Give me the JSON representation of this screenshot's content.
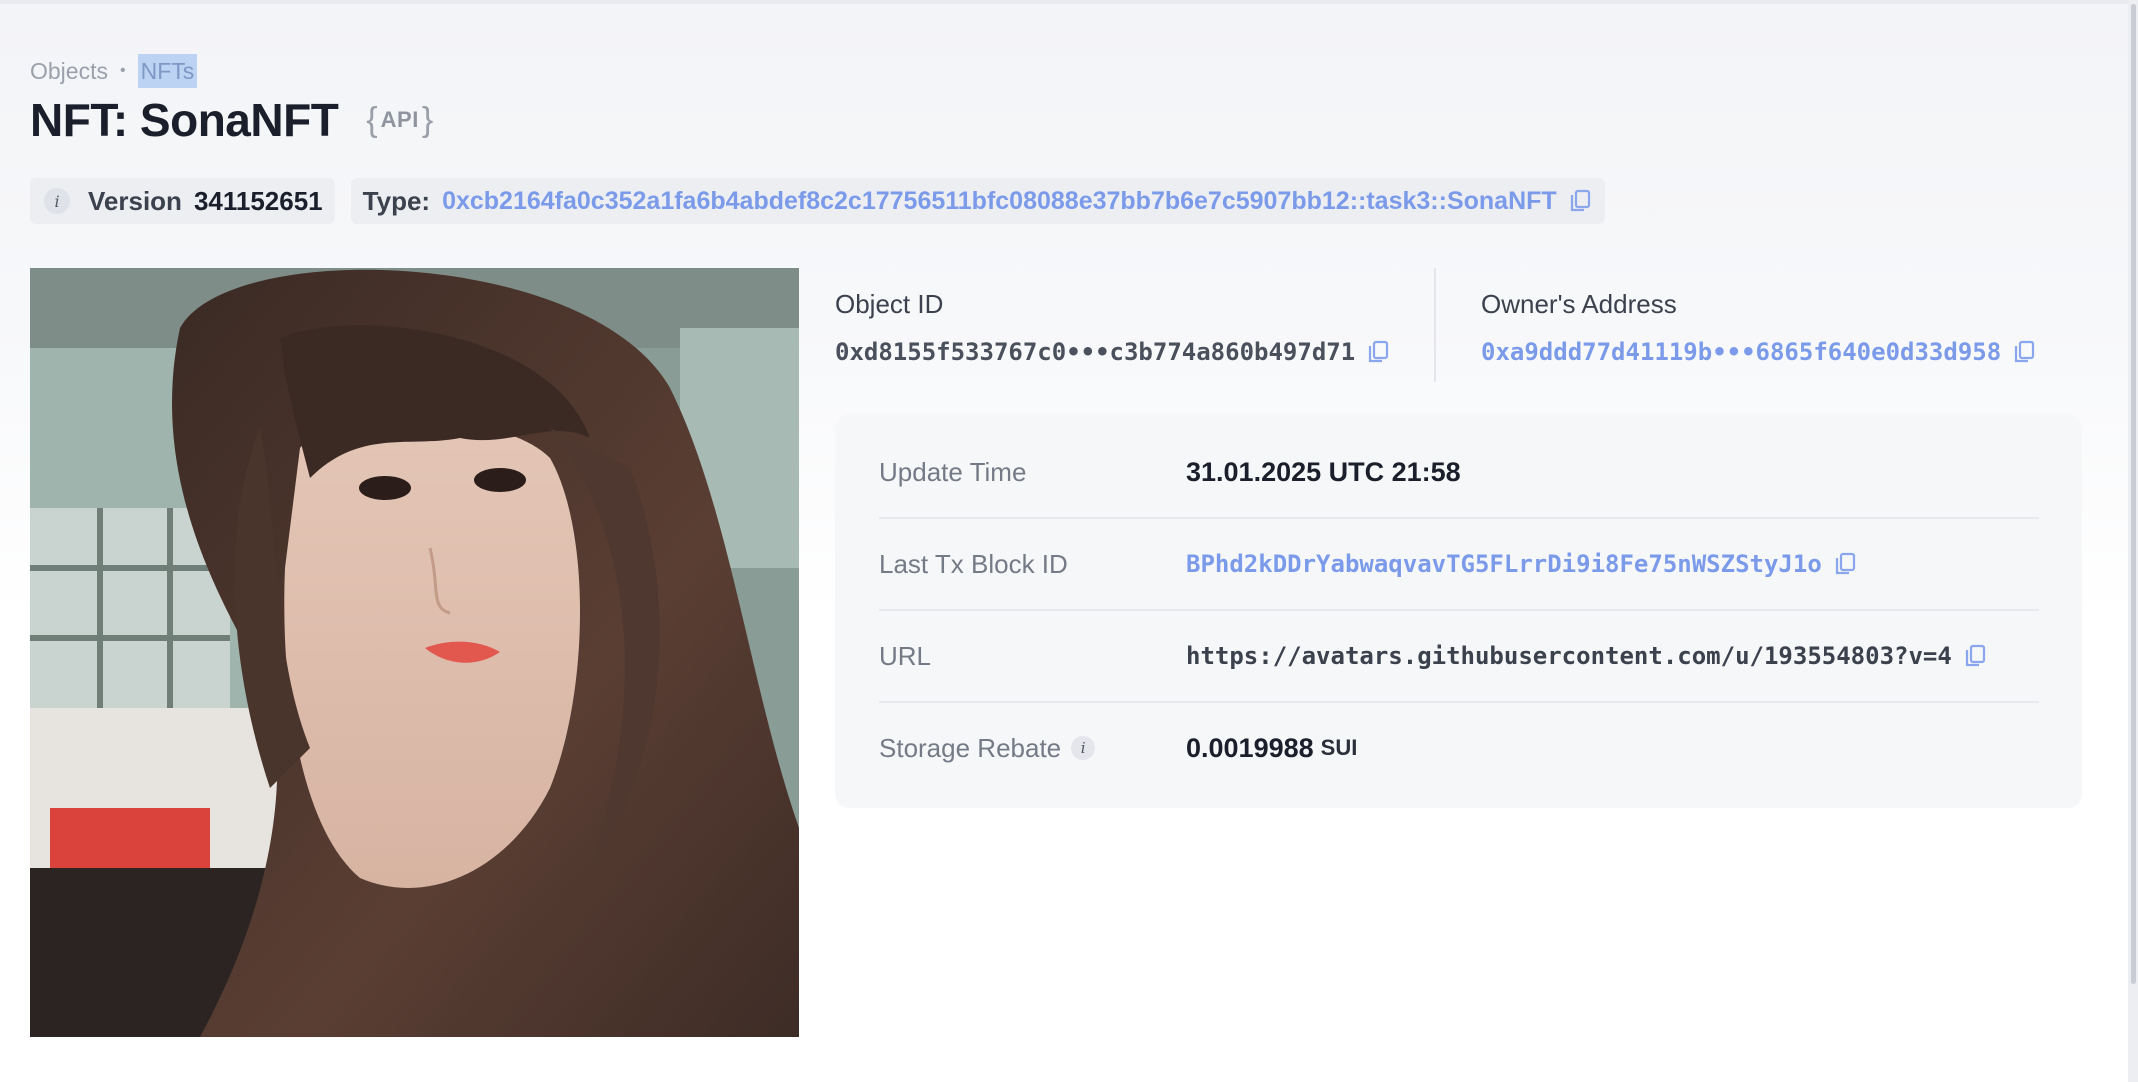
{
  "breadcrumb": {
    "parent": "Objects",
    "separator": "•",
    "current": "NFTs"
  },
  "header": {
    "title": "NFT: SonaNFT",
    "api_open": "{",
    "api_label": "API",
    "api_close": "}"
  },
  "version": {
    "info_glyph": "i",
    "label": "Version",
    "value": "341152651"
  },
  "type": {
    "label": "Type:",
    "value": "0xcb2164fa0c352a1fa6b4abdef8c2c17756511bfc08088e37bb7b6e7c5907bb12::task3::SonaNFT"
  },
  "object": {
    "label": "Object ID",
    "value": "0xd8155f533767c0•••c3b774a860b497d71"
  },
  "owner": {
    "label": "Owner's Address",
    "value": "0xa9ddd77d41119b•••6865f640e0d33d958"
  },
  "details": {
    "update_time": {
      "label": "Update Time",
      "value": "31.01.2025 UTC 21:58"
    },
    "last_tx": {
      "label": "Last Tx Block ID",
      "value": "BPhd2kDDrYabwaqvavTG5FLrrDi9i8Fe75nWSZStyJ1o"
    },
    "url": {
      "label": "URL",
      "value": "https://avatars.githubusercontent.com/u/193554803?v=4"
    },
    "storage_rebate": {
      "label": "Storage Rebate",
      "info_glyph": "i",
      "value": "0.0019988",
      "unit": "SUI"
    }
  },
  "icons": {
    "copy": "copy-icon",
    "info": "info-icon"
  },
  "colors": {
    "link": "#7b9bea",
    "breadcrumb_highlight": "#bcd3f3",
    "title": "#1a1f2b"
  }
}
